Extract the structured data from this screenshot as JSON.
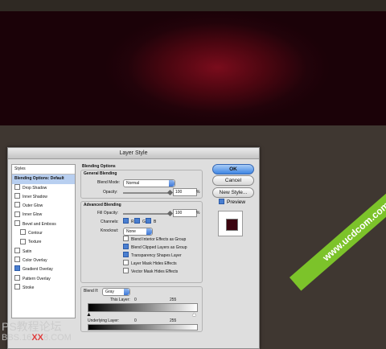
{
  "dialog": {
    "title": "Layer Style"
  },
  "styles_list": [
    {
      "label": "Styles",
      "checkbox": false,
      "checked": false,
      "selected": false,
      "indent": false
    },
    {
      "label": "Blending Options: Default",
      "checkbox": false,
      "checked": false,
      "selected": true,
      "indent": false
    },
    {
      "label": "Drop Shadow",
      "checkbox": true,
      "checked": false,
      "selected": false,
      "indent": false
    },
    {
      "label": "Inner Shadow",
      "checkbox": true,
      "checked": false,
      "selected": false,
      "indent": false
    },
    {
      "label": "Outer Glow",
      "checkbox": true,
      "checked": false,
      "selected": false,
      "indent": false
    },
    {
      "label": "Inner Glow",
      "checkbox": true,
      "checked": false,
      "selected": false,
      "indent": false
    },
    {
      "label": "Bevel and Emboss",
      "checkbox": true,
      "checked": false,
      "selected": false,
      "indent": false
    },
    {
      "label": "Contour",
      "checkbox": true,
      "checked": false,
      "selected": false,
      "indent": true
    },
    {
      "label": "Texture",
      "checkbox": true,
      "checked": false,
      "selected": false,
      "indent": true
    },
    {
      "label": "Satin",
      "checkbox": true,
      "checked": false,
      "selected": false,
      "indent": false
    },
    {
      "label": "Color Overlay",
      "checkbox": true,
      "checked": false,
      "selected": false,
      "indent": false
    },
    {
      "label": "Gradient Overlay",
      "checkbox": true,
      "checked": true,
      "selected": false,
      "indent": false
    },
    {
      "label": "Pattern Overlay",
      "checkbox": true,
      "checked": false,
      "selected": false,
      "indent": false
    },
    {
      "label": "Stroke",
      "checkbox": true,
      "checked": false,
      "selected": false,
      "indent": false
    }
  ],
  "blending": {
    "section_title": "Blending Options",
    "general_title": "General Blending",
    "blend_mode_label": "Blend Mode:",
    "blend_mode_value": "Normal",
    "opacity_label": "Opacity:",
    "opacity_value": "100",
    "opacity_unit": "%",
    "advanced_title": "Advanced Blending",
    "fill_opacity_label": "Fill Opacity:",
    "fill_opacity_value": "100",
    "fill_unit": "%",
    "channels_label": "Channels:",
    "channel_r": "R",
    "channel_g": "G",
    "channel_b": "B",
    "knockout_label": "Knockout:",
    "knockout_value": "None",
    "options": [
      {
        "label": "Blend Interior Effects as Group",
        "checked": false
      },
      {
        "label": "Blend Clipped Layers as Group",
        "checked": true
      },
      {
        "label": "Transparency Shapes Layer",
        "checked": true
      },
      {
        "label": "Layer Mask Hides Effects",
        "checked": false
      },
      {
        "label": "Vector Mask Hides Effects",
        "checked": false
      }
    ],
    "blend_if_label": "Blend If:",
    "blend_if_value": "Gray",
    "this_layer_label": "This Layer:",
    "this_layer_min": "0",
    "this_layer_max": "255",
    "underlying_label": "Underlying Layer:",
    "underlying_min": "0",
    "underlying_max": "255"
  },
  "buttons": {
    "ok": "OK",
    "cancel": "Cancel",
    "new_style": "New Style...",
    "preview": "Preview"
  },
  "watermarks": {
    "left_text": "PS教程论坛",
    "left_url_a": "BBS.16",
    "left_url_red": "XX",
    "left_url_b": "8.COM",
    "ribbon": "www.ucdcom.com"
  },
  "colors": {
    "canvas_red": "#7a0c1c",
    "accent_blue": "#3f86e3",
    "swatch": "#3c0510"
  }
}
